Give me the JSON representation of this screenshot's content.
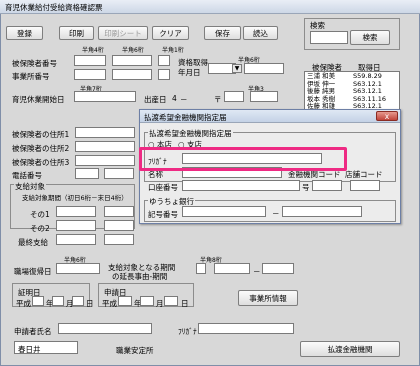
{
  "window": {
    "title": "育児休業給付受給資格確認票"
  },
  "toolbar": {
    "register": "登録",
    "print": "印刷",
    "print_sheet": "印刷シート",
    "clear": "クリア",
    "save": "保存",
    "load": "読込"
  },
  "labels": {
    "half_width_4": "半角4桁",
    "half_width_6": "半角6桁",
    "half_width_7": "半角7桁",
    "half_width_8": "半角8桁",
    "half_width_1": "半角1桁",
    "half_width_11": "半角11桁",
    "insured_number": "被保険者番号",
    "office_number": "事業所番号",
    "qual_date": "資格取得",
    "year_month_day": "年月日",
    "leave_start": "育児休業開始日",
    "birth_date": "出産日",
    "dash": "－",
    "zip": "〒",
    "address1": "被保険者の住所1",
    "address2": "被保険者の住所2",
    "address3": "被保険者の住所3",
    "phone": "電話番号",
    "payment_target": "支給対象",
    "period_header": "支給対象期間（初日6桁－末日4桁）",
    "sono1": "その1",
    "sono2": "その2",
    "last_payment": "最終支給",
    "return_date": "職場復帰日",
    "extension_header": "支給対象となる期間",
    "extension_reason": "の延長事由-期間",
    "certificate_date": "証明日",
    "application_date": "申請日",
    "heisei": "平成",
    "year": "年",
    "month": "月",
    "day": "日",
    "applicant_name": "申請者氏名",
    "furigana": "ﾌﾘｶﾞﾅ",
    "employment_office": "職業安定所"
  },
  "right_panel": {
    "search_label": "検索",
    "search_button": "検索",
    "col_insured": "被保険者",
    "col_acquired": "取得日",
    "records": [
      {
        "name": "三浦 和美",
        "date": "S59.8.29"
      },
      {
        "name": "伊坂 伸一",
        "date": "S63.12.1"
      },
      {
        "name": "後藤 純男",
        "date": "S63.12.1"
      },
      {
        "name": "坂本 秀樹",
        "date": "S63.11.16"
      },
      {
        "name": "佐藤 和雄",
        "date": "S63.12.1"
      }
    ]
  },
  "buttons": {
    "office_info": "事業所情報",
    "transfer_bank": "払渡金融機関"
  },
  "inputs": {
    "employment_office": "春日井"
  },
  "dialog": {
    "title": "払渡希望金融機関指定届",
    "group1_title": "払渡希望金融機関指定届",
    "branch_options": [
      "本店",
      "支店"
    ],
    "furigana_label": "ﾌﾘｶﾞﾅ",
    "name_label": "名称",
    "bank_code_label": "金融機関コード",
    "branch_code_label": "店舗コード",
    "account_label": "口座番号",
    "number_suffix": "号",
    "group2_title": "ゆうちょ銀行",
    "symbol_label": "記号番号",
    "dash": "－",
    "close": "x"
  }
}
